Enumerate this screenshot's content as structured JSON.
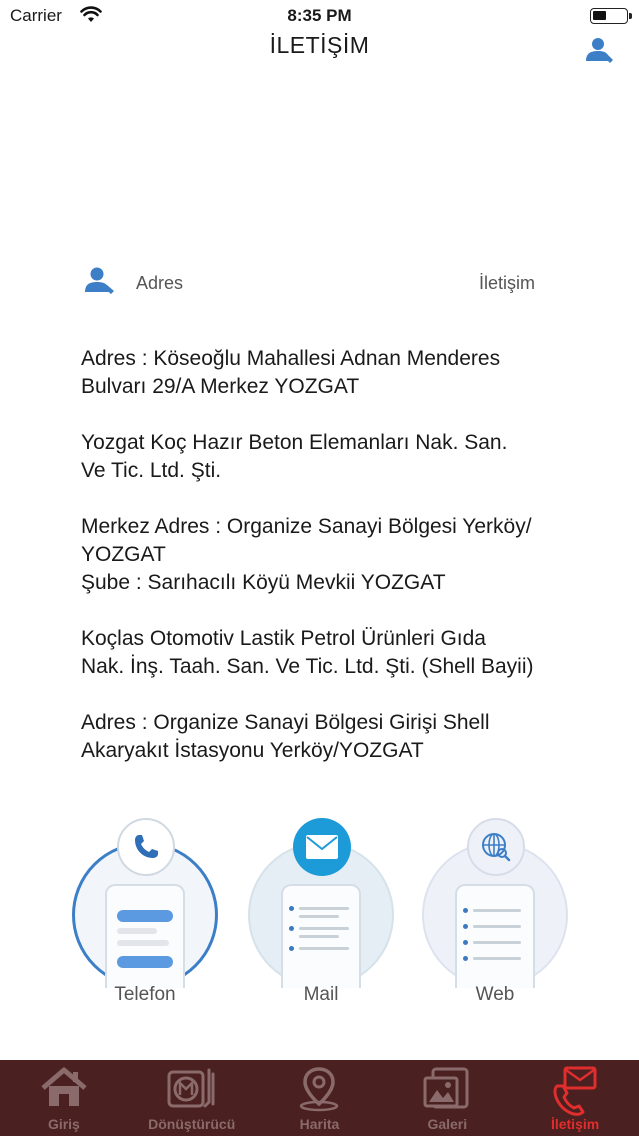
{
  "status_bar": {
    "carrier": "Carrier",
    "time": "8:35 PM"
  },
  "nav": {
    "title": "İLETİŞİM",
    "profile_icon": "person-icon"
  },
  "header_row": {
    "left_label": "Adres",
    "right_label": "İletişim",
    "icon": "person-icon"
  },
  "address": {
    "paragraphs": [
      "Adres : Köseoğlu Mahallesi Adnan Menderes\nBulvarı 29/A Merkez YOZGAT",
      "Yozgat Koç Hazır Beton Elemanları Nak. San.\nVe Tic. Ltd. Şti.",
      "Merkez Adres : Organize Sanayi Bölgesi Yerköy/\nYOZGAT\nŞube : Sarıhacılı Köyü Mevkii YOZGAT",
      "Koçlas Otomotiv Lastik Petrol Ürünleri Gıda\nNak. İnş. Taah. San. Ve Tic. Ltd. Şti. (Shell Bayii)",
      "Adres : Organize Sanayi Bölgesi Girişi Shell\nAkaryakıt İstasyonu Yerköy/YOZGAT"
    ]
  },
  "contacts": {
    "phone": {
      "label": "Telefon",
      "icon": "phone-icon"
    },
    "mail": {
      "label": "Mail",
      "icon": "envelope-icon"
    },
    "web": {
      "label": "Web",
      "icon": "globe-icon"
    }
  },
  "tabs": [
    {
      "label": "Giriş",
      "icon": "home-icon",
      "active": false
    },
    {
      "label": "Dönüştürücü",
      "icon": "converter-icon",
      "active": false
    },
    {
      "label": "Harita",
      "icon": "map-pin-icon",
      "active": false
    },
    {
      "label": "Galeri",
      "icon": "gallery-icon",
      "active": false
    },
    {
      "label": "İletişim",
      "icon": "contact-icon",
      "active": true
    }
  ],
  "colors": {
    "accent": "#3c7fc7",
    "tab_bar_bg": "#4a2020",
    "tab_active": "#e02d2d",
    "tab_inactive": "#8a6a6a",
    "mail_badge": "#1d9bd8"
  }
}
